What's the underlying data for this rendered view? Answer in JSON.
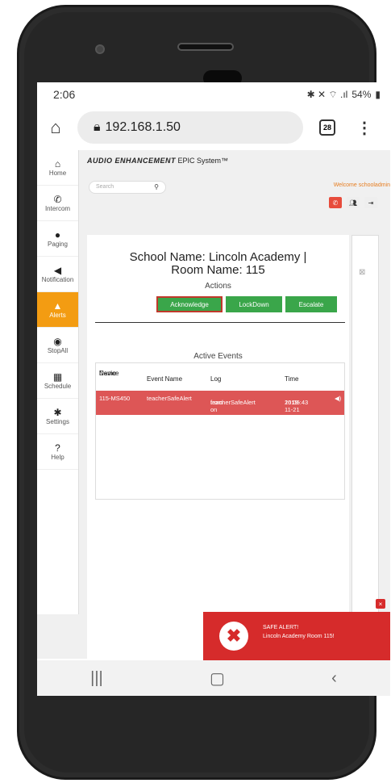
{
  "status": {
    "time": "2:06",
    "icons": "✱ ✕ ⌔ .ıl",
    "battery": "54%"
  },
  "browser": {
    "url": "192.168.1.50",
    "tab_count": "28"
  },
  "sidebar": {
    "items": [
      {
        "label": "Home",
        "icon": "home-icon"
      },
      {
        "label": "Intercom",
        "icon": "phone-icon"
      },
      {
        "label": "Paging",
        "icon": "microphone-icon"
      },
      {
        "label": "Notification",
        "icon": "speaker-icon"
      },
      {
        "label": "Alerts",
        "icon": "warning-icon"
      },
      {
        "label": "StopAll",
        "icon": "stop-icon"
      },
      {
        "label": "Schedule",
        "icon": "calendar-icon"
      },
      {
        "label": "Settings",
        "icon": "gear-icon"
      },
      {
        "label": "Help",
        "icon": "help-icon"
      }
    ]
  },
  "header": {
    "brand_bold": "AUDIO ENHANCEMENT",
    "brand_rest": "EPIC System™",
    "search_placeholder": "Search",
    "welcome": "Welcome schooladmin"
  },
  "main": {
    "school_line1": "School Name: Lincoln Academy |",
    "school_line2": "Room Name: 115",
    "actions_label": "Actions",
    "buttons": {
      "acknowledge": "Acknowledge",
      "lockdown": "LockDown",
      "escalate": "Escalate"
    },
    "events_label": "Active Events",
    "columns": {
      "device_1": "Device",
      "device_2": "Name",
      "event": "Event Name",
      "log": "Log",
      "time": "Time"
    },
    "row": {
      "device": "115-MS450",
      "event": "teacherSafeAlert",
      "log_1": "teacherSafeAlert",
      "log_2": "from on 115-MS450",
      "time_1": "2019-11-21",
      "time_2": "16:06:43"
    }
  },
  "alert": {
    "title": "SAFE ALERT!",
    "message": "Lincoln Academy Room 115!"
  },
  "colors": {
    "accent": "#f39c12",
    "alert": "#d62b2b",
    "row": "#dd5656",
    "button": "#3aa64a"
  }
}
